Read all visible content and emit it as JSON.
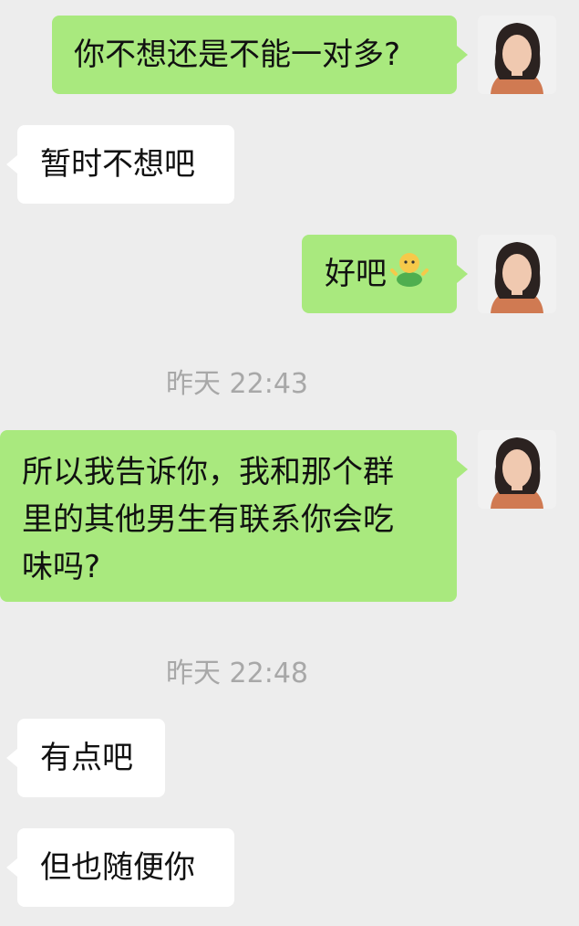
{
  "messages": [
    {
      "side": "sent",
      "text": "你不想还是不能一对多?"
    },
    {
      "side": "received",
      "text": "暂时不想吧"
    },
    {
      "side": "sent",
      "text": "好吧",
      "emoji": "shrug-person-emoji"
    },
    {
      "timestamp": "昨天 22:43"
    },
    {
      "side": "sent",
      "lines": [
        "所以我告诉你，我和那个群",
        "里的其他男生有联系你会吃",
        "味吗?"
      ]
    },
    {
      "timestamp": "昨天 22:48"
    },
    {
      "side": "received",
      "text": "有点吧"
    },
    {
      "side": "received",
      "text": "但也随便你"
    }
  ],
  "colors": {
    "background": "#ededed",
    "sent_bubble": "#a9e97e",
    "received_bubble": "#ffffff",
    "timestamp_text": "#a8a8a8"
  }
}
